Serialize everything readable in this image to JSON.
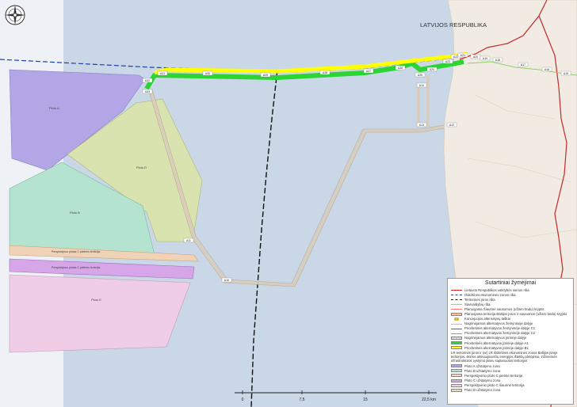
{
  "map": {
    "country_label": "LATVIJOS RESPUBLIKA",
    "zone_labels": {
      "zone_a": "Ploto A",
      "zone_d": "Ploto D",
      "zone_b": "Ploto B",
      "corridor_1": "Perspektyvus plotas C pietines teritorija",
      "corridor_2": "Perspektyvus plotas C pietines teritorija",
      "zone_e": "Ploto E"
    },
    "point_labels": [
      "A33",
      "A32",
      "A31",
      "A30",
      "A29",
      "A28",
      "A27",
      "A26",
      "A25",
      "A24",
      "A23",
      "A22",
      "A21",
      "A20",
      "A19",
      "A18",
      "A17",
      "A16",
      "A15",
      "A14",
      "A13",
      "A12",
      "A11",
      "A10"
    ],
    "colors": {
      "sea": "#c9d7e6",
      "land": "#f1ebe3",
      "zone_a": "#b3a6e6",
      "zone_b": "#b4e3cf",
      "zone_c": "#d9e3b0",
      "zone_d": "#d6a6e8",
      "zone_e": "#efcde6",
      "corridor_yellow": "#ffff00",
      "corridor_green": "#2cd434"
    }
  },
  "scale": {
    "ticks": [
      "0",
      "7,5",
      "15",
      "22,5 km"
    ]
  },
  "legend": {
    "title": "Sutartiniai žymėjimai",
    "items": [
      {
        "label": "Lietuvos Respublikos valstybės sienos riba",
        "color": "#d22020",
        "kind": "line"
      },
      {
        "label": "Išskirtinės ekonominės zonos riba",
        "color": "#1d3fa8",
        "kind": "dash"
      },
      {
        "label": "Teritorinės jūros riba",
        "color": "#111111",
        "kind": "dash"
      },
      {
        "label": "Savivaldybių riba",
        "color": "#b8b8b8",
        "kind": "line"
      },
      {
        "label": "Planuojama Šiaurinė sausumos (užlaro būdu) kryptis",
        "color": "#f27272",
        "kind": "line"
      },
      {
        "label": "Planuojama teritorija Baltijos jūros ir sausumos (užlaro būdu) kryptis",
        "color": "#f3c48f",
        "kind": "fill"
      },
      {
        "label": "Koncepcijos alternatyvų taškai",
        "color": "#d8b93e",
        "kind": "dot"
      },
      {
        "label": "Nagrinėjamos alternatyvos žemyninėje dalyje",
        "color": "#9fd67c",
        "kind": "line"
      },
      {
        "label": "Prioritetinės alternatyvos žemyninėje dalyje C1",
        "color": "#2e8b2e",
        "kind": "line"
      },
      {
        "label": "Prioritetinės alternatyvos žemyninėje dalyje C2",
        "color": "#59a9d4",
        "kind": "line"
      },
      {
        "label": "Nagrinėjamos alternatyvos jūrinėje dalyje",
        "color": "#e0d6c6",
        "kind": "fill"
      },
      {
        "label": "Prioritetinės alternatyvos jūrinėje dalyje A1",
        "color": "#2cd434",
        "kind": "fill"
      },
      {
        "label": "Prioritetinės alternatyvos jūrinėje dalyje B1",
        "color": "#ffff00",
        "kind": "fill"
      }
    ],
    "note": "LR teritorinės jūros ir (ar) LR išskirtinės ekonominės zonos Baltijos jūroje teritorijos, skirtos atsinaujinančių energijos išteklių plėtojimui, inžinerinės infrastruktūros vystymo planu suplanuotos teritorijos",
    "zones": [
      {
        "label": "Ploto A užstatymo zona",
        "color": "#b3a6e6"
      },
      {
        "label": "Ploto B užstatymo zona",
        "color": "#b4e3cf"
      },
      {
        "label": "Perspektyvinio ploto C pietinė teritorija",
        "color": "#f0d2b7"
      },
      {
        "label": "Ploto C užstatymo zona",
        "color": "#d6a6e8"
      },
      {
        "label": "Perspektyvinio ploto C šiaurinė teritorija",
        "color": "#efcde6"
      },
      {
        "label": "Ploto D užstatymo zona",
        "color": "#d9e3b0"
      }
    ]
  }
}
